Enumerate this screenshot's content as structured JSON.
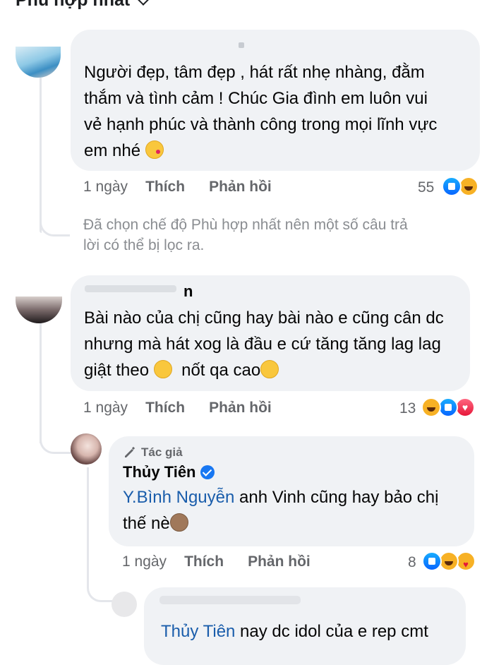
{
  "sort": {
    "label": "Phù hợp nhất"
  },
  "comments": [
    {
      "text": "Người đẹp, tâm đẹp , hát rất nhẹ nhàng, đằm thắm và tình cảm ! Chúc Gia đình em luôn vui vẻ hạnh phúc và thành công trong mọi lĩnh vực em nhé",
      "line1": "Người đẹp, tâm đẹp , hát rất nhẹ nhàng, đằm",
      "line2": "thắm và tình cảm ! Chúc Gia đình em luôn vui",
      "line3": "vẻ hạnh phúc và thành công trong mọi lĩnh vực",
      "line4": "em nhé",
      "time": "1 ngày",
      "like_label": "Thích",
      "reply_label": "Phản hồi",
      "reaction_count": "55",
      "reactions": [
        "like",
        "haha"
      ]
    },
    {
      "author_partial": "n",
      "line1": "Bài nào của chị cũng hay bài nào e cũng cân dc",
      "line2": "nhưng mà hát xog là đầu e cứ tăng tăng lag lag",
      "line3a": "giật theo",
      "line3b": "nốt qa cao",
      "time": "1 ngày",
      "like_label": "Thích",
      "reply_label": "Phản hồi",
      "reaction_count": "13",
      "reactions": [
        "haha",
        "like",
        "love"
      ]
    }
  ],
  "filter_note": {
    "line1": "Đã chọn chế độ Phù hợp nhất nên một số câu trả",
    "line2": "lời có thể bị lọc ra."
  },
  "author_reply": {
    "badge": "Tác giả",
    "author": "Thủy Tiên",
    "mention": "Y.Bình Nguyễn",
    "line1_rest": " anh Vinh cũng hay bảo chị",
    "line2": "thế nè",
    "time": "1 ngày",
    "like_label": "Thích",
    "reply_label": "Phản hồi",
    "reaction_count": "8",
    "reactions": [
      "like",
      "haha",
      "care"
    ]
  },
  "partial_reply": {
    "mention": "Thủy Tiên",
    "rest": " nay dc idol của e rep cmt"
  },
  "colors": {
    "bubble": "#f0f2f5",
    "link": "#1a5dab",
    "meta": "#65676b",
    "verified": "#1877f2"
  }
}
